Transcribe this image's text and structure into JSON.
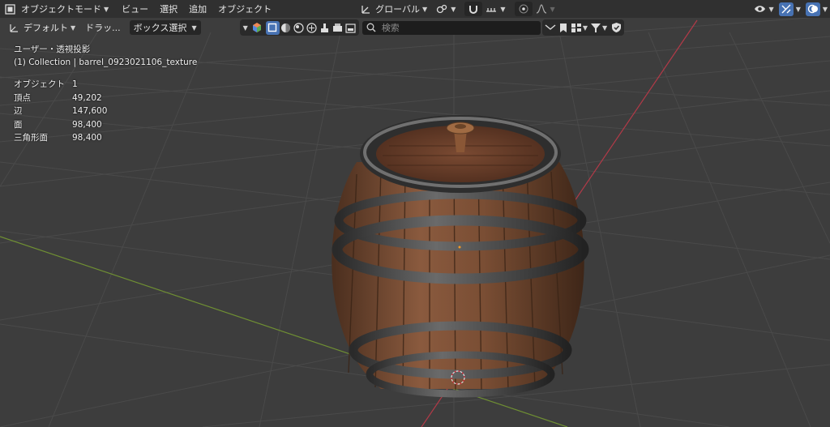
{
  "header": {
    "mode": "オブジェクトモード",
    "menus": [
      "ビュー",
      "選択",
      "追加",
      "オブジェクト"
    ],
    "transform_orientation": "グローバル"
  },
  "toolbar": {
    "orientation_preset": "デフォルト",
    "drag": "ドラッ...",
    "select_mode": "ボックス選択",
    "search_placeholder": "検索"
  },
  "overlay": {
    "view_name": "ユーザー・透視投影",
    "collection": "(1) Collection | barrel_0923021106_texture"
  },
  "stats": [
    {
      "label": "オブジェクト",
      "value": "1"
    },
    {
      "label": "頂点",
      "value": "49,202"
    },
    {
      "label": "辺",
      "value": "147,600"
    },
    {
      "label": "面",
      "value": "98,400"
    },
    {
      "label": "三角形面",
      "value": "98,400"
    }
  ],
  "colors": {
    "header_bg": "#303030",
    "viewport_bg": "#3d3d3d",
    "accent_blue": "#4772b3",
    "x_axis": "#c4424f",
    "y_axis": "#7ea231"
  }
}
